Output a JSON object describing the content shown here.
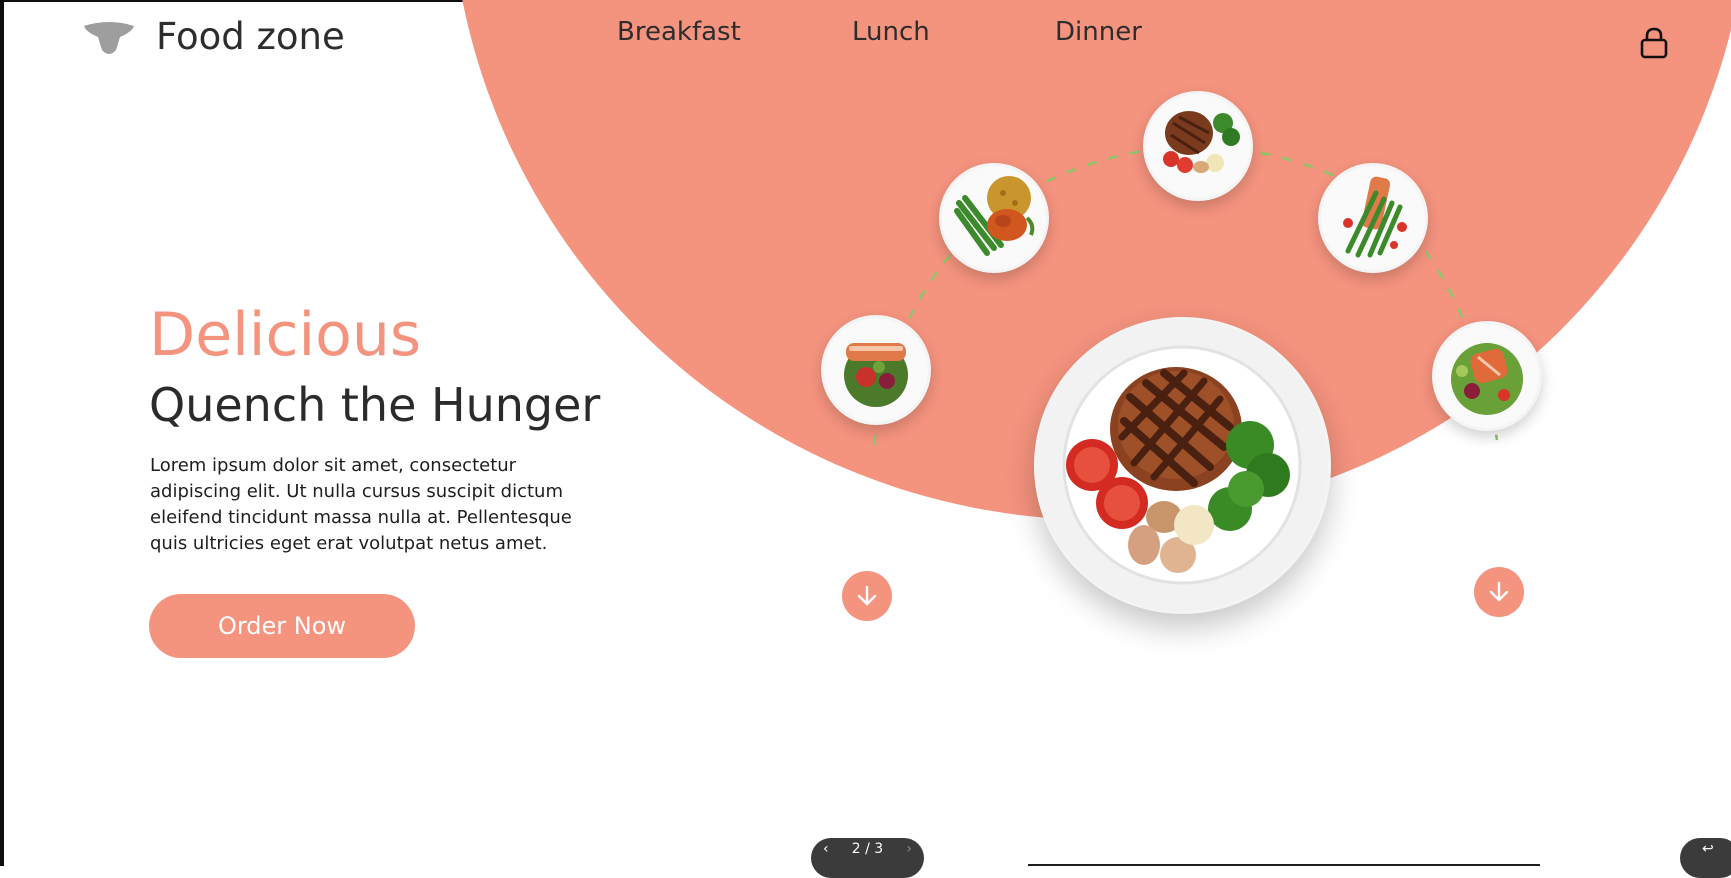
{
  "brand": {
    "name": "Food zone",
    "icon": "dome-lamp-icon"
  },
  "nav": {
    "items": [
      "Breakfast",
      "Lunch",
      "Dinner"
    ],
    "lock_icon": "lock-icon"
  },
  "hero": {
    "accent": "Delicious",
    "headline": "Quench the Hunger",
    "description": "Lorem ipsum dolor sit amet, consectetur adipiscing elit. Ut nulla cursus suscipit dictum eleifend tincidunt massa nulla at. Pellentesque quis ultricies eget erat volutpat netus amet.",
    "cta": "Order Now"
  },
  "dishes": [
    {
      "name": "salmon-salad-dish"
    },
    {
      "name": "chicken-green-beans-rice-dish"
    },
    {
      "name": "steak-vegetables-dish"
    },
    {
      "name": "asparagus-salmon-dish"
    },
    {
      "name": "salmon-greens-dish"
    }
  ],
  "featured_dish": {
    "name": "grilled-steak-plate"
  },
  "pager": {
    "text": "2 / 3",
    "prev_icon": "chevron-left-icon",
    "next_icon": "chevron-right-icon"
  },
  "colors": {
    "accent": "#f4937e",
    "text": "#2b2b2b",
    "arc_dash": "#8fc56a",
    "pager_bg": "#3b3b3b"
  }
}
